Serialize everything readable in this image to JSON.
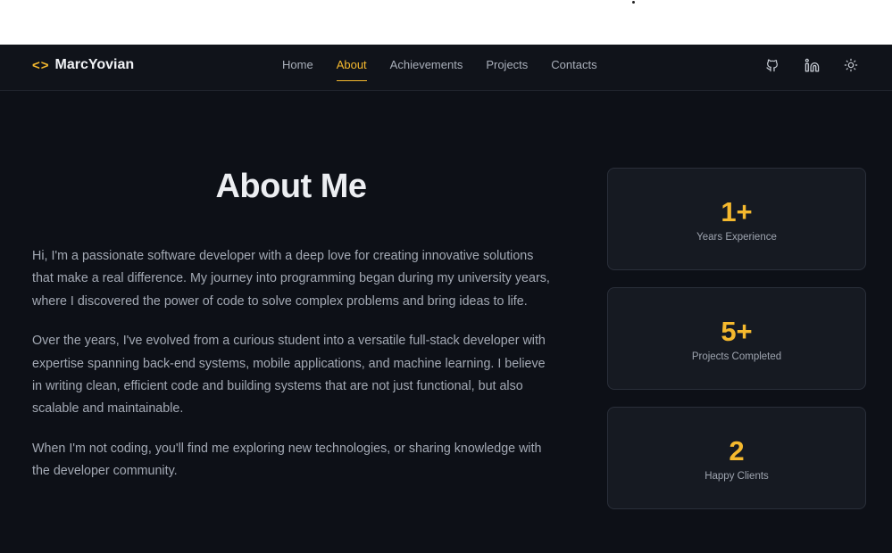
{
  "brand": {
    "icon": "code-brackets-icon",
    "name": "MarcYovian"
  },
  "nav": {
    "links": [
      {
        "label": "Home",
        "active": false
      },
      {
        "label": "About",
        "active": true
      },
      {
        "label": "Achievements",
        "active": false
      },
      {
        "label": "Projects",
        "active": false
      },
      {
        "label": "Contacts",
        "active": false
      }
    ],
    "icons": [
      "github-icon",
      "linkedin-icon",
      "sun-icon"
    ]
  },
  "about": {
    "title": "About Me",
    "paragraphs": [
      "Hi, I'm a passionate software developer with a deep love for creating innovative solutions that make a real difference. My journey into programming began during my university years, where I discovered the power of code to solve complex problems and bring ideas to life.",
      "Over the years, I've evolved from a curious student into a versatile full-stack developer with expertise spanning back-end systems, mobile applications, and machine learning. I believe in writing clean, efficient code and building systems that are not just functional, but also scalable and maintainable.",
      "When I'm not coding, you'll find me exploring new technologies, or sharing knowledge with the developer community."
    ]
  },
  "stats": [
    {
      "value": "1+",
      "label": "Years Experience"
    },
    {
      "value": "5+",
      "label": "Projects Completed"
    },
    {
      "value": "2",
      "label": "Happy Clients"
    }
  ],
  "colors": {
    "accent": "#f5b92e",
    "background": "#0d1017",
    "card": "#161a22"
  }
}
